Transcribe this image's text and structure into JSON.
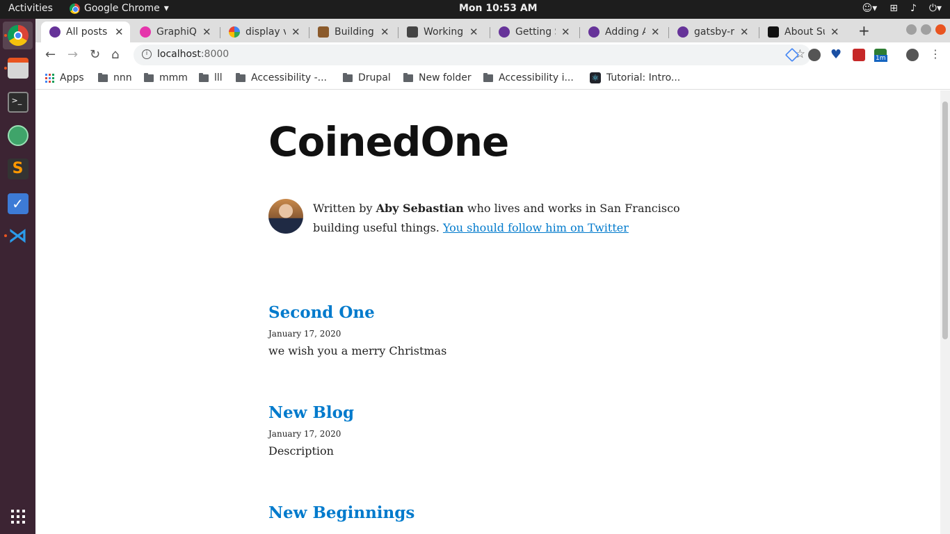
{
  "topbar": {
    "activities": "Activities",
    "app_name": "Google Chrome",
    "clock": "Mon 10:53 AM"
  },
  "tabs": [
    {
      "label": "All posts |",
      "active": true
    },
    {
      "label": "GraphiQL"
    },
    {
      "label": "display vi"
    },
    {
      "label": "Building a"
    },
    {
      "label": "Working w"
    },
    {
      "label": "Getting S"
    },
    {
      "label": "Adding A"
    },
    {
      "label": "gatsby-re"
    },
    {
      "label": "About Su"
    }
  ],
  "omnibox": {
    "host": "localhost",
    "port": ":8000"
  },
  "bookmarks": [
    "Apps",
    "nnn",
    "mmm",
    "lll",
    "Accessibility -...",
    "Drupal",
    "New folder",
    "Accessibility i...",
    "Tutorial: Intro..."
  ],
  "extensions": {
    "badge": "1m"
  },
  "page": {
    "site_title": "CoinedOne",
    "bio": {
      "prefix": "Written by ",
      "author": "Aby Sebastian",
      "middle": " who lives and works in San Francisco building useful things. ",
      "link": "You should follow him on Twitter"
    },
    "posts": [
      {
        "title": "Second One",
        "date": "January 17, 2020",
        "description": "we wish you a merry Christmas"
      },
      {
        "title": "New Blog",
        "date": "January 17, 2020",
        "description": "Description"
      },
      {
        "title": "New Beginnings",
        "date": "",
        "description": ""
      }
    ]
  }
}
